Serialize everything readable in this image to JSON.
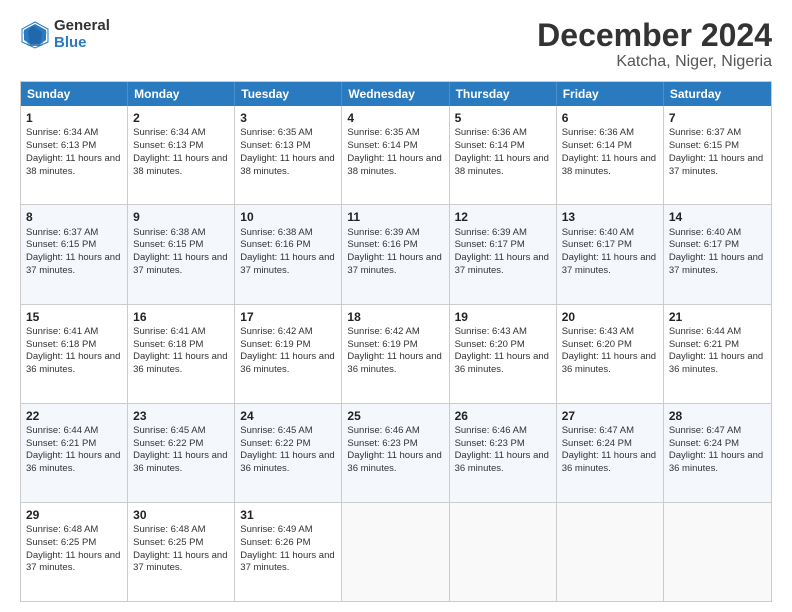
{
  "logo": {
    "general": "General",
    "blue": "Blue"
  },
  "title": "December 2024",
  "subtitle": "Katcha, Niger, Nigeria",
  "days": [
    "Sunday",
    "Monday",
    "Tuesday",
    "Wednesday",
    "Thursday",
    "Friday",
    "Saturday"
  ],
  "weeks": [
    [
      {
        "day": 1,
        "sunrise": "6:34 AM",
        "sunset": "6:13 PM",
        "daylight": "11 hours and 38 minutes."
      },
      {
        "day": 2,
        "sunrise": "6:34 AM",
        "sunset": "6:13 PM",
        "daylight": "11 hours and 38 minutes."
      },
      {
        "day": 3,
        "sunrise": "6:35 AM",
        "sunset": "6:13 PM",
        "daylight": "11 hours and 38 minutes."
      },
      {
        "day": 4,
        "sunrise": "6:35 AM",
        "sunset": "6:14 PM",
        "daylight": "11 hours and 38 minutes."
      },
      {
        "day": 5,
        "sunrise": "6:36 AM",
        "sunset": "6:14 PM",
        "daylight": "11 hours and 38 minutes."
      },
      {
        "day": 6,
        "sunrise": "6:36 AM",
        "sunset": "6:14 PM",
        "daylight": "11 hours and 38 minutes."
      },
      {
        "day": 7,
        "sunrise": "6:37 AM",
        "sunset": "6:15 PM",
        "daylight": "11 hours and 37 minutes."
      }
    ],
    [
      {
        "day": 8,
        "sunrise": "6:37 AM",
        "sunset": "6:15 PM",
        "daylight": "11 hours and 37 minutes."
      },
      {
        "day": 9,
        "sunrise": "6:38 AM",
        "sunset": "6:15 PM",
        "daylight": "11 hours and 37 minutes."
      },
      {
        "day": 10,
        "sunrise": "6:38 AM",
        "sunset": "6:16 PM",
        "daylight": "11 hours and 37 minutes."
      },
      {
        "day": 11,
        "sunrise": "6:39 AM",
        "sunset": "6:16 PM",
        "daylight": "11 hours and 37 minutes."
      },
      {
        "day": 12,
        "sunrise": "6:39 AM",
        "sunset": "6:17 PM",
        "daylight": "11 hours and 37 minutes."
      },
      {
        "day": 13,
        "sunrise": "6:40 AM",
        "sunset": "6:17 PM",
        "daylight": "11 hours and 37 minutes."
      },
      {
        "day": 14,
        "sunrise": "6:40 AM",
        "sunset": "6:17 PM",
        "daylight": "11 hours and 37 minutes."
      }
    ],
    [
      {
        "day": 15,
        "sunrise": "6:41 AM",
        "sunset": "6:18 PM",
        "daylight": "11 hours and 36 minutes."
      },
      {
        "day": 16,
        "sunrise": "6:41 AM",
        "sunset": "6:18 PM",
        "daylight": "11 hours and 36 minutes."
      },
      {
        "day": 17,
        "sunrise": "6:42 AM",
        "sunset": "6:19 PM",
        "daylight": "11 hours and 36 minutes."
      },
      {
        "day": 18,
        "sunrise": "6:42 AM",
        "sunset": "6:19 PM",
        "daylight": "11 hours and 36 minutes."
      },
      {
        "day": 19,
        "sunrise": "6:43 AM",
        "sunset": "6:20 PM",
        "daylight": "11 hours and 36 minutes."
      },
      {
        "day": 20,
        "sunrise": "6:43 AM",
        "sunset": "6:20 PM",
        "daylight": "11 hours and 36 minutes."
      },
      {
        "day": 21,
        "sunrise": "6:44 AM",
        "sunset": "6:21 PM",
        "daylight": "11 hours and 36 minutes."
      }
    ],
    [
      {
        "day": 22,
        "sunrise": "6:44 AM",
        "sunset": "6:21 PM",
        "daylight": "11 hours and 36 minutes."
      },
      {
        "day": 23,
        "sunrise": "6:45 AM",
        "sunset": "6:22 PM",
        "daylight": "11 hours and 36 minutes."
      },
      {
        "day": 24,
        "sunrise": "6:45 AM",
        "sunset": "6:22 PM",
        "daylight": "11 hours and 36 minutes."
      },
      {
        "day": 25,
        "sunrise": "6:46 AM",
        "sunset": "6:23 PM",
        "daylight": "11 hours and 36 minutes."
      },
      {
        "day": 26,
        "sunrise": "6:46 AM",
        "sunset": "6:23 PM",
        "daylight": "11 hours and 36 minutes."
      },
      {
        "day": 27,
        "sunrise": "6:47 AM",
        "sunset": "6:24 PM",
        "daylight": "11 hours and 36 minutes."
      },
      {
        "day": 28,
        "sunrise": "6:47 AM",
        "sunset": "6:24 PM",
        "daylight": "11 hours and 36 minutes."
      }
    ],
    [
      {
        "day": 29,
        "sunrise": "6:48 AM",
        "sunset": "6:25 PM",
        "daylight": "11 hours and 37 minutes."
      },
      {
        "day": 30,
        "sunrise": "6:48 AM",
        "sunset": "6:25 PM",
        "daylight": "11 hours and 37 minutes."
      },
      {
        "day": 31,
        "sunrise": "6:49 AM",
        "sunset": "6:26 PM",
        "daylight": "11 hours and 37 minutes."
      },
      null,
      null,
      null,
      null
    ]
  ]
}
